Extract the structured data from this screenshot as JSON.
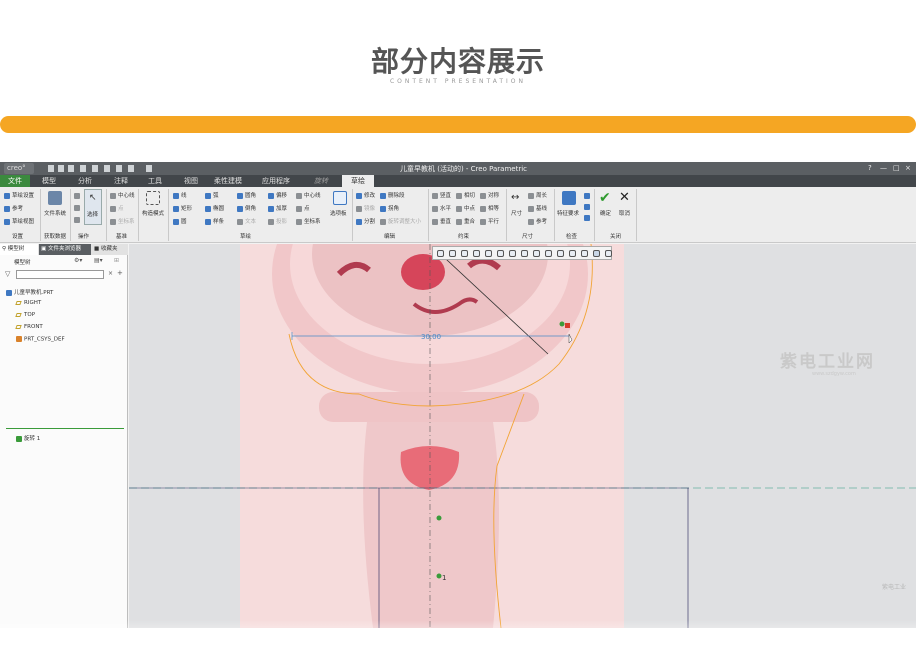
{
  "banner": {
    "title": "部分内容展示",
    "subtitle": "CONTENT PRESENTATION",
    "accent_color": "#f5a623"
  },
  "app": {
    "logo": "creo°",
    "window_title": "儿童早教机 (活动的) - Creo Parametric",
    "window_controls": [
      "?",
      "—",
      "□",
      "×"
    ]
  },
  "menu": {
    "tabs": [
      "文件",
      "模型",
      "分析",
      "注释",
      "工具",
      "视图",
      "柔性建模",
      "应用程序",
      "旋转",
      "草绘"
    ],
    "active_tab": "草绘",
    "file_color": "#3b8a3e"
  },
  "ribbon": {
    "setup": {
      "items": [
        "草绘设置",
        "参考",
        "草绘视图"
      ],
      "group": "设置"
    },
    "getdata": {
      "items": [
        "文件系统"
      ],
      "group": "获取数据"
    },
    "operate": {
      "items": [
        "选择"
      ],
      "group": "操作"
    },
    "datum": {
      "items": [
        "中心线",
        "点",
        "坐标系"
      ],
      "group": "基准"
    },
    "construct": {
      "items": [
        "构造模式"
      ]
    },
    "sketch": {
      "items": [
        "线",
        "矩形",
        "圆",
        "弧",
        "椭圆",
        "样条",
        "圆角",
        "倒角",
        "文本",
        "偏移",
        "加厚",
        "投影",
        "中心线",
        "点",
        "坐标系"
      ],
      "palette": "选项板",
      "group": "草绘"
    },
    "edit": {
      "items": [
        "修改",
        "删除段",
        "镜像",
        "拐角",
        "分割",
        "旋转调整大小"
      ],
      "group": "编辑"
    },
    "constrain": {
      "items": [
        "竖直",
        "相切",
        "对称",
        "水平",
        "中点",
        "相等",
        "垂直",
        "重合",
        "平行"
      ],
      "group": "约束"
    },
    "dimension": {
      "items": [
        "尺寸",
        "周长",
        "基线",
        "参考"
      ],
      "group": "尺寸"
    },
    "inspect": {
      "items": [
        "特征要求"
      ],
      "group": "检查"
    },
    "close": {
      "ok": "确定",
      "cancel": "取消",
      "group": "关闭"
    }
  },
  "panel": {
    "tabs": [
      "模型树",
      "文件夹浏览器",
      "收藏夹"
    ],
    "tree_label": "模型树",
    "items": [
      {
        "label": "儿童早教机.PRT",
        "type": "part"
      },
      {
        "label": "RIGHT",
        "type": "plane"
      },
      {
        "label": "TOP",
        "type": "plane"
      },
      {
        "label": "FRONT",
        "type": "plane"
      },
      {
        "label": "PRT_CSYS_DEF",
        "type": "csys"
      },
      {
        "label": "旋转 1",
        "type": "feature"
      }
    ]
  },
  "viewport": {
    "dimension_value": "30.00",
    "point_label": "1",
    "dashed_color": "#66b0a0",
    "sketch_color": "#f2a435"
  },
  "watermark": {
    "text": "紫电工业网",
    "url": "www.szdgyw.com",
    "corner_mark": "紫电工业"
  }
}
